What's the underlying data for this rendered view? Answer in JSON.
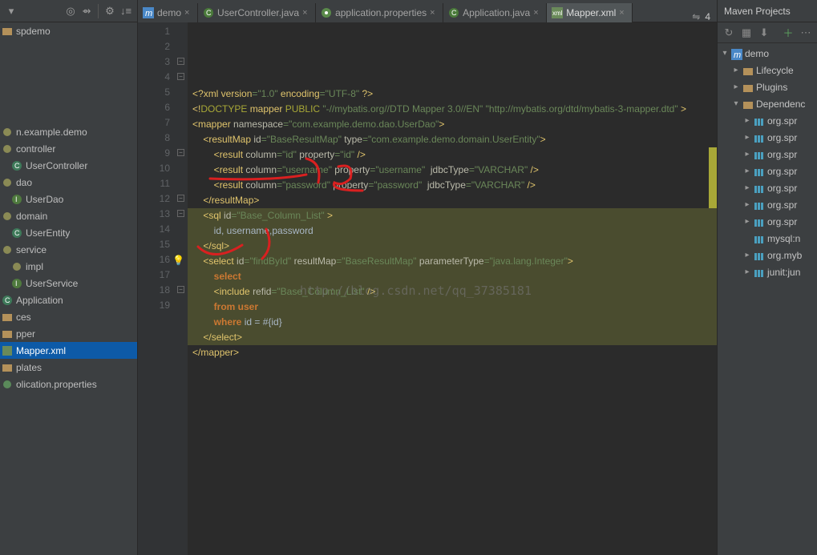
{
  "toolbar_icons": [
    "arrow-down",
    "target",
    "align",
    "sep",
    "gear",
    "sort"
  ],
  "tabs": [
    {
      "label": "demo",
      "icon": "m",
      "active": false
    },
    {
      "label": "UserController.java",
      "icon": "cls",
      "active": false
    },
    {
      "label": "application.properties",
      "icon": "props",
      "active": false
    },
    {
      "label": "Application.java",
      "icon": "cls",
      "active": false
    },
    {
      "label": "Mapper.xml",
      "icon": "xml",
      "active": true
    }
  ],
  "right_toggle_label": "4",
  "maven_title": "Maven Projects",
  "project_tree": [
    {
      "label": "spdemo",
      "type": "folder",
      "indent": 0
    },
    {
      "label": "",
      "type": "spacer",
      "indent": 0
    },
    {
      "label": "",
      "type": "spacer",
      "indent": 0
    },
    {
      "label": "",
      "type": "spacer",
      "indent": 0
    },
    {
      "label": "",
      "type": "spacer",
      "indent": 0
    },
    {
      "label": "",
      "type": "spacer",
      "indent": 0
    },
    {
      "label": "n.example.demo",
      "type": "pkg",
      "indent": 0
    },
    {
      "label": "controller",
      "type": "pkg",
      "indent": 0
    },
    {
      "label": "UserController",
      "type": "class",
      "indent": 1
    },
    {
      "label": "dao",
      "type": "pkg",
      "indent": 0
    },
    {
      "label": "UserDao",
      "type": "iface",
      "indent": 1
    },
    {
      "label": "domain",
      "type": "pkg",
      "indent": 0
    },
    {
      "label": "UserEntity",
      "type": "class",
      "indent": 1
    },
    {
      "label": "service",
      "type": "pkg",
      "indent": 0
    },
    {
      "label": "impl",
      "type": "pkg",
      "indent": 1
    },
    {
      "label": "UserService",
      "type": "iface",
      "indent": 1
    },
    {
      "label": "Application",
      "type": "class",
      "indent": 0
    },
    {
      "label": "ces",
      "type": "folder",
      "indent": 0
    },
    {
      "label": "pper",
      "type": "folder",
      "indent": 0
    },
    {
      "label": "Mapper.xml",
      "type": "xml",
      "indent": 0,
      "selected": true
    },
    {
      "label": "plates",
      "type": "folder",
      "indent": 0
    },
    {
      "label": "olication.properties",
      "type": "props",
      "indent": 0
    }
  ],
  "lines": [
    "1",
    "2",
    "3",
    "4",
    "5",
    "6",
    "7",
    "8",
    "9",
    "10",
    "11",
    "12",
    "13",
    "14",
    "15",
    "16",
    "17",
    "18",
    "19"
  ],
  "code": {
    "l1": {
      "a": "<?",
      "b": "xml version",
      "c": "=\"1.0\"",
      "d": " encoding",
      "e": "=\"UTF-8\"",
      "f": " ?>"
    },
    "l2": {
      "a": "<!",
      "b": "DOCTYPE ",
      "c": "mapper ",
      "d": "PUBLIC ",
      "e": "\"-//mybatis.org//DTD Mapper 3.0//EN\" \"http://mybatis.org/dtd/mybatis-3-mapper.dtd\"",
      "f": " >"
    },
    "l3": {
      "a": "<",
      "b": "mapper ",
      "c": "namespace",
      "d": "=\"com.example.demo.dao.UserDao\"",
      "e": ">"
    },
    "l4": {
      "a": "    <",
      "b": "resultMap ",
      "c": "id",
      "d": "=\"BaseResultMap\"",
      "e": " type",
      "f": "=\"com.example.demo.domain.UserEntity\"",
      "g": ">"
    },
    "l5": {
      "a": "        <",
      "b": "result ",
      "c": "column",
      "d": "=\"id\"",
      "e": " property",
      "f": "=\"id\"",
      "g": " />"
    },
    "l6": {
      "a": "        <",
      "b": "result ",
      "c": "column",
      "d": "=\"username\"",
      "e": " property",
      "f": "=\"username\"",
      "g": "  jdbcType",
      "h": "=\"VARCHAR\"",
      "i": " />"
    },
    "l7": {
      "a": "        <",
      "b": "result ",
      "c": "column",
      "d": "=\"password\"",
      "e": " property",
      "f": "=\"password\"",
      "g": "  jdbcType",
      "h": "=\"VARCHAR\"",
      "i": " />"
    },
    "l8": {
      "a": "    </",
      "b": "resultMap",
      "c": ">"
    },
    "l9": {
      "a": "    <",
      "b": "sql ",
      "c": "id",
      "d": "=\"Base_Column_List\"",
      "e": " >"
    },
    "l10": {
      "a": "        id, username,password"
    },
    "l11": {
      "a": "    </",
      "b": "sql",
      "c": ">"
    },
    "l12": {
      "a": "    <",
      "b": "select ",
      "c": "id",
      "d": "=\"findById\"",
      "e": " resultMap",
      "f": "=\"BaseResultMap\"",
      "g": " parameterType",
      "h": "=\"java.lang.Integer\"",
      "i": ">"
    },
    "l13": {
      "a": "        ",
      "b": "select"
    },
    "l14": {
      "a": "        <",
      "b": "include ",
      "c": "refid",
      "d": "=\"Base_Column_List\"",
      "e": " />"
    },
    "l15": {
      "a": "        ",
      "b": "from ",
      "c": "user"
    },
    "l16": {
      "a": "        ",
      "b": "where ",
      "c": "id = #{id}"
    },
    "l17": {
      "a": "    </",
      "b": "select",
      "c": ">"
    },
    "l18": {
      "a": "</",
      "b": "mapper",
      "c": ">"
    }
  },
  "watermark": "http://blog.csdn.net/qq_37385181",
  "maven_tree": [
    {
      "exp": "▾",
      "icon": "m",
      "label": "demo",
      "indent": 0
    },
    {
      "exp": "▸",
      "icon": "folder",
      "label": "Lifecycle",
      "indent": 1
    },
    {
      "exp": "▸",
      "icon": "folder",
      "label": "Plugins",
      "indent": 1
    },
    {
      "exp": "▾",
      "icon": "folder",
      "label": "Dependenc",
      "indent": 1
    },
    {
      "exp": "▸",
      "icon": "lib",
      "label": "org.spr",
      "indent": 2
    },
    {
      "exp": "▸",
      "icon": "lib",
      "label": "org.spr",
      "indent": 2
    },
    {
      "exp": "▸",
      "icon": "lib",
      "label": "org.spr",
      "indent": 2
    },
    {
      "exp": "▸",
      "icon": "lib",
      "label": "org.spr",
      "indent": 2
    },
    {
      "exp": "▸",
      "icon": "lib",
      "label": "org.spr",
      "indent": 2
    },
    {
      "exp": "▸",
      "icon": "lib",
      "label": "org.spr",
      "indent": 2
    },
    {
      "exp": "▸",
      "icon": "lib",
      "label": "org.spr",
      "indent": 2
    },
    {
      "exp": "",
      "icon": "lib",
      "label": "mysql:n",
      "indent": 2
    },
    {
      "exp": "▸",
      "icon": "lib",
      "label": "org.myb",
      "indent": 2
    },
    {
      "exp": "▸",
      "icon": "lib",
      "label": "junit:jun",
      "indent": 2
    }
  ]
}
